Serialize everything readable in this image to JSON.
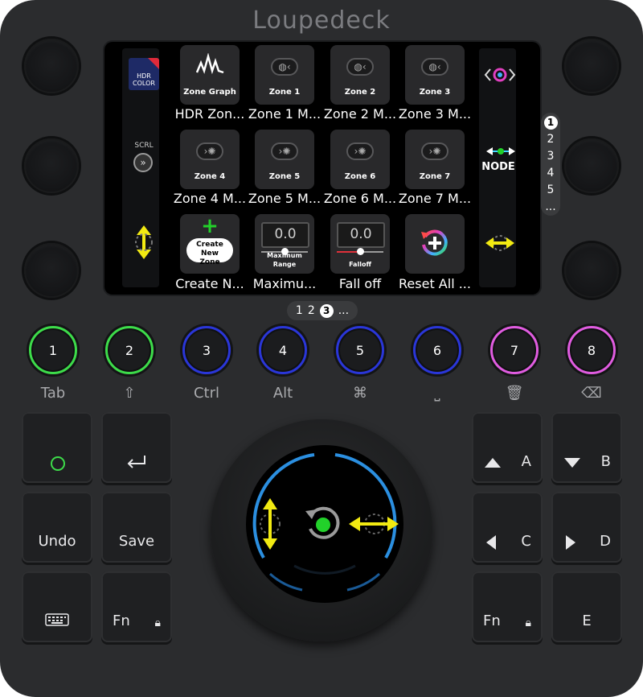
{
  "brand": "Loupedeck",
  "screen": {
    "left_column": {
      "top_label": "HDR COLOR",
      "middle_label": "SCRL"
    },
    "right_column": {
      "middle_label": "NODE"
    },
    "cells": [
      {
        "title": "Zone Graph",
        "caption": "HDR Zon..."
      },
      {
        "title": "Zone 1",
        "caption": "Zone 1 M..."
      },
      {
        "title": "Zone 2",
        "caption": "Zone 2 M..."
      },
      {
        "title": "Zone 3",
        "caption": "Zone 3 M..."
      },
      {
        "title": "Zone 4",
        "caption": "Zone 4 M..."
      },
      {
        "title": "Zone 5",
        "caption": "Zone 5 M..."
      },
      {
        "title": "Zone 6",
        "caption": "Zone 6 M..."
      },
      {
        "title": "Zone 7",
        "caption": "Zone 7 M..."
      },
      {
        "title": "Create New Zone",
        "caption": "Create N..."
      },
      {
        "title": "Maximum Range",
        "value": "0.0",
        "caption": "Maximu..."
      },
      {
        "title": "Falloff",
        "value": "0.0",
        "caption": "Fall off"
      },
      {
        "title": "",
        "caption": "Reset All ..."
      }
    ]
  },
  "side_pager": [
    "1",
    "2",
    "3",
    "4",
    "5",
    "..."
  ],
  "bottom_pager": [
    "1",
    "2",
    "3",
    "..."
  ],
  "round_buttons": [
    {
      "label": "1",
      "sub": "Tab",
      "color": "#3ddc4a"
    },
    {
      "label": "2",
      "sub": "⇧",
      "color": "#3ddc4a"
    },
    {
      "label": "3",
      "sub": "Ctrl",
      "color": "#2a36d8"
    },
    {
      "label": "4",
      "sub": "Alt",
      "color": "#2a36d8"
    },
    {
      "label": "5",
      "sub": "⌘",
      "color": "#2a36d8"
    },
    {
      "label": "6",
      "sub": "⎵",
      "color": "#2a36d8"
    },
    {
      "label": "7",
      "sub": "🗑",
      "color": "#e05ce0"
    },
    {
      "label": "8",
      "sub": "⌫",
      "color": "#e05ce0"
    }
  ],
  "keys": {
    "left": [
      "",
      "",
      "Undo",
      "Save",
      "",
      "Fn"
    ],
    "right": [
      "A",
      "B",
      "C",
      "D",
      "Fn",
      "E"
    ]
  },
  "colors": {
    "accent_green": "#22d12a",
    "accent_yellow": "#f2ea12",
    "wheel_blue": "#2b8fe0"
  }
}
